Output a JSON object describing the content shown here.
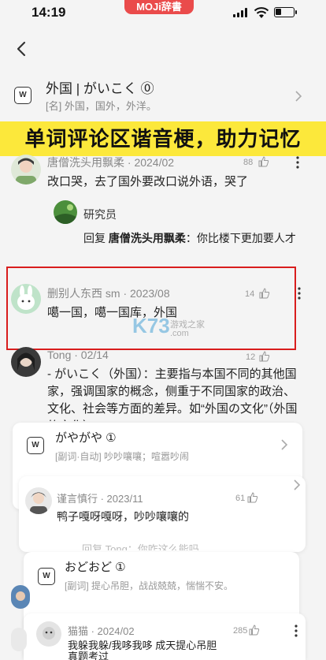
{
  "status_bar": {
    "time": "14:19",
    "app_badge": "MOJi辞書"
  },
  "word": {
    "title": "外国 | がいこく ⓪",
    "definition": "[名] 外国，国外，外洋。"
  },
  "banner": {
    "text": "单词评论区谐音梗，助力记忆"
  },
  "comments": [
    {
      "user": "唐僧洗头用飘柔 · 2024/02",
      "likes": "88",
      "text": "改口哭，去了国外要改口说外语，哭了"
    },
    {
      "user": "删别人东西 sm · 2023/08",
      "likes": "14",
      "text": "噶一国，噶一国库，外国"
    },
    {
      "user": "Tong · 02/14",
      "likes": "12",
      "text": "- がいこく（外国）：主要指与本国不同的其他国家，强调国家的概念，侧重于不同国家的政治、文化、社会等方面的差异。如“外国の文化”（外国的文化）"
    }
  ],
  "reply": {
    "user": "研究员",
    "prefix": "回复",
    "target": "唐僧洗头用飘柔",
    "text": "：你比楼下更加要人才"
  },
  "popup1": {
    "word": "がやがや ①",
    "definition": "[副词·自动] 吵吵嚷嚷；喧嚣吵闹",
    "comment_user": "谨言慎行 · 2023/11",
    "comment_likes": "61",
    "comment_text": "鸭子嘎呀嘎呀，吵吵嚷嚷的",
    "obscured_text": "回复  Tong：你咋这么能吗"
  },
  "popup2": {
    "word": "おどおど ①",
    "definition": "[副词] 提心吊胆，战战兢兢，惴惴不安。",
    "comment_user": "猫猫 · 2024/02",
    "comment_likes": "285",
    "comment_text": "我躲我躲/我哆我哆  成天提心吊胆",
    "comment_text2": "真题考过"
  },
  "watermark": {
    "big": "K73",
    "line1": "游戏之家",
    "line2": ".com"
  },
  "colors": {
    "banner": "#fce83b",
    "highlight_border": "#d91d1d",
    "brand": "#ea4b4b"
  }
}
